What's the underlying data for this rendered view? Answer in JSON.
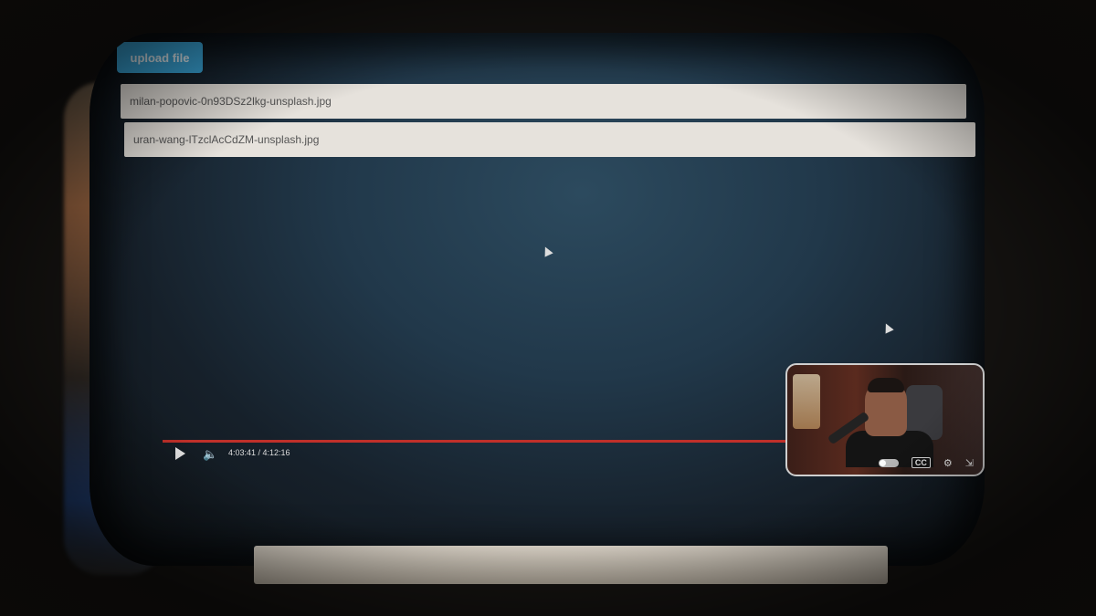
{
  "toolbar": {
    "upload_label": "upload file"
  },
  "files": [
    {
      "name": "milan-popovic-0n93DSz2lkg-unsplash.jpg"
    },
    {
      "name": "uran-wang-lTzclAcCdZM-unsplash.jpg"
    }
  ],
  "player": {
    "current_time": "4:03:41",
    "duration": "4:12:16",
    "time_display": "4:03:41 / 4:12:16",
    "progress": 0.97,
    "progress_color": "#c0302a"
  },
  "pip": {
    "cc_label": "CC"
  },
  "colors": {
    "upload_button": "#3aa8dc",
    "screen_bg": "#21384a"
  },
  "icons": [
    "play-icon",
    "volume-icon",
    "autoplay-toggle-icon",
    "cc-icon",
    "gear-icon",
    "exit-fullscreen-icon",
    "mouse-pointer-icon"
  ]
}
